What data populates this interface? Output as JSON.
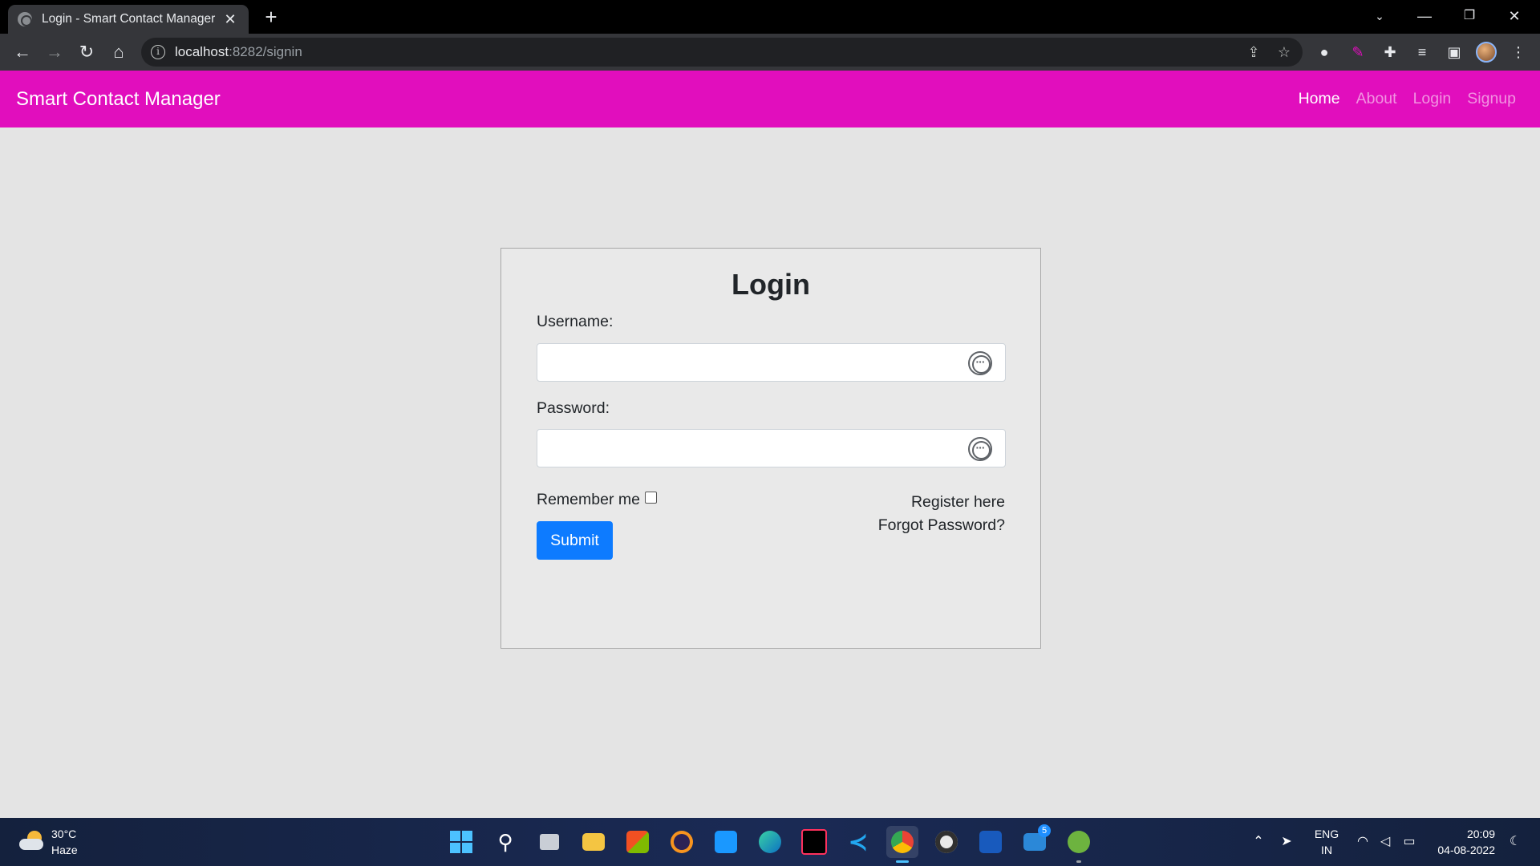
{
  "browser": {
    "tab_title": "Login - Smart Contact Manager",
    "url_host": "localhost",
    "url_rest": ":8282/signin"
  },
  "navbar": {
    "brand": "Smart Contact Manager",
    "links": [
      "Home",
      "About",
      "Login",
      "Signup"
    ],
    "bg_color": "#e10ebd"
  },
  "login": {
    "heading": "Login",
    "username_label": "Username:",
    "password_label": "Password:",
    "remember_label": "Remember me",
    "submit_label": "Submit",
    "register_link": "Register here",
    "forgot_link": "Forgot Password?",
    "submit_color": "#0d7bff"
  },
  "taskbar": {
    "weather_temp": "30°C",
    "weather_desc": "Haze",
    "lang": "ENG",
    "region": "IN",
    "time": "20:09",
    "date": "04-08-2022",
    "mail_badge": "5"
  }
}
